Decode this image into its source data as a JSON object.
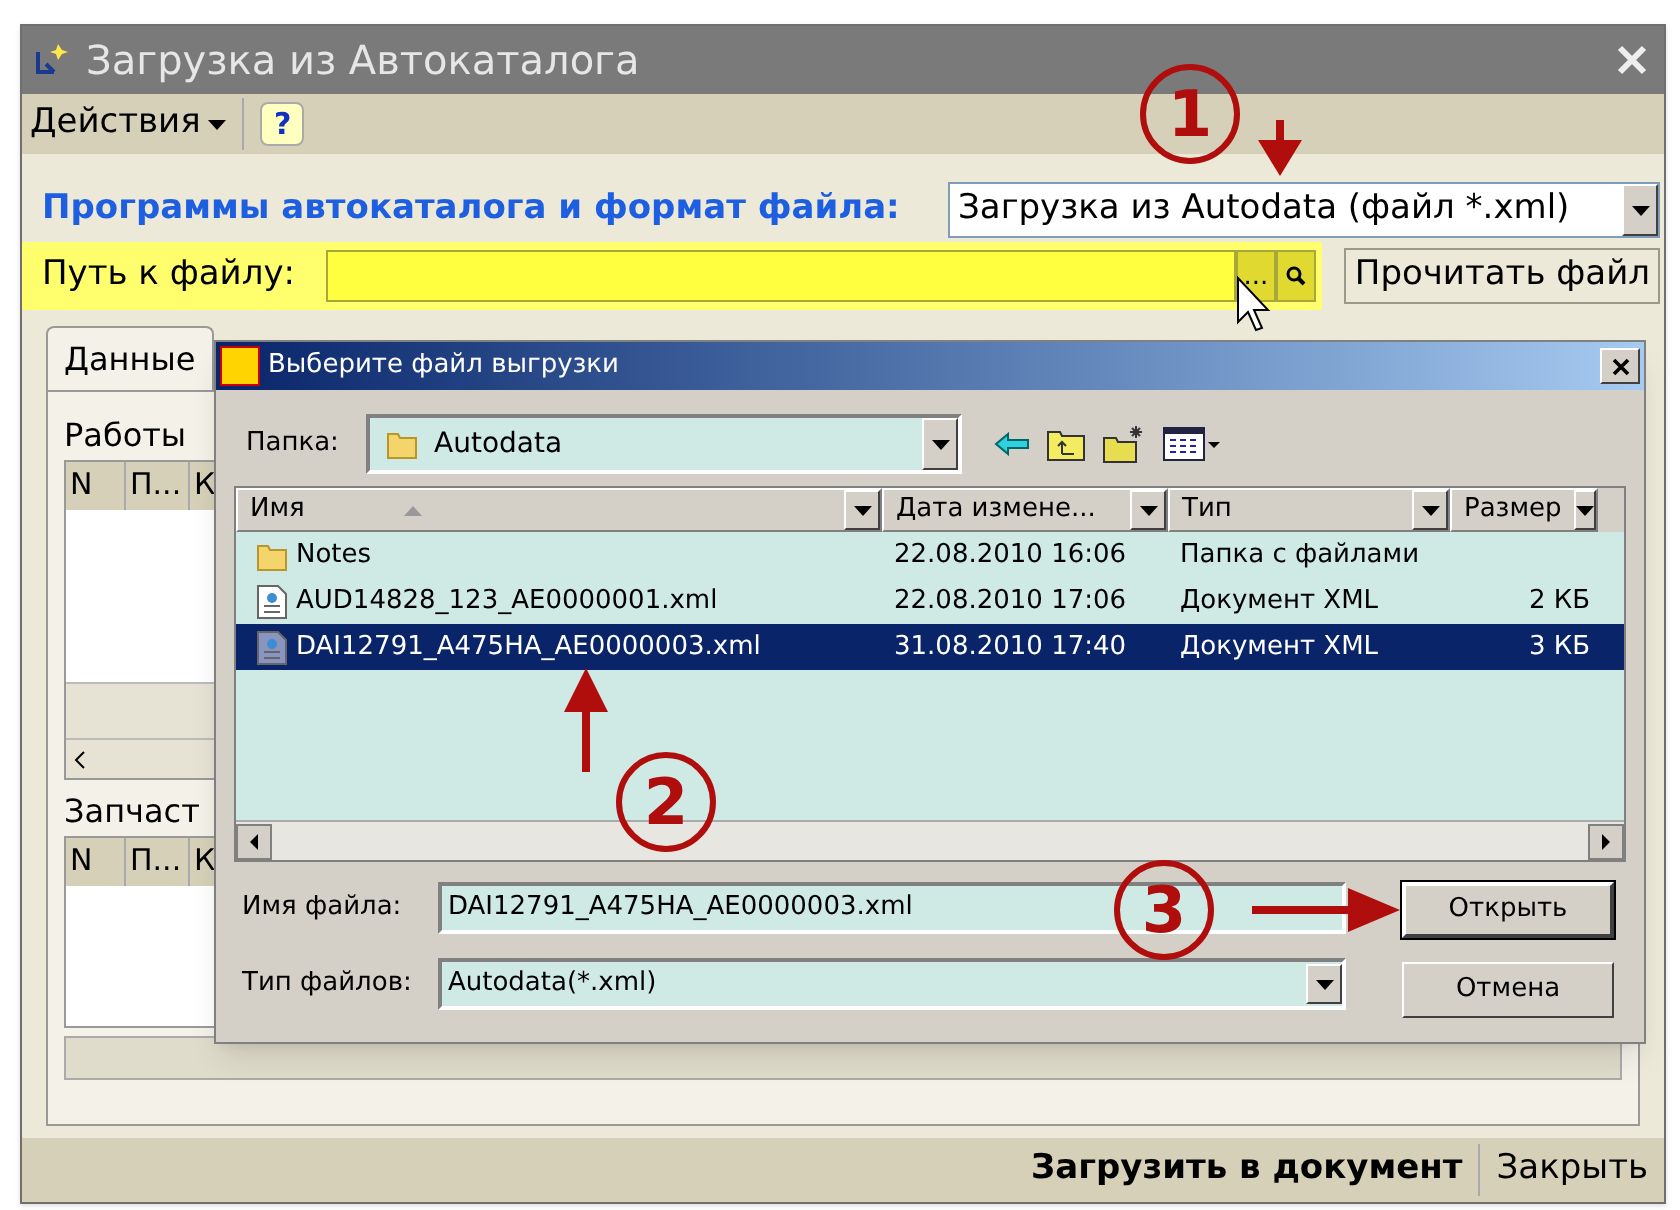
{
  "window": {
    "title": "Загрузка из Автокаталога"
  },
  "toolbar": {
    "actions_menu": "Действия",
    "help": "?"
  },
  "form": {
    "program_label": "Программы автокаталога и формат файла:",
    "program_value": "Загрузка из Autodata (файл *.xml)",
    "path_label": "Путь к файлу:",
    "browse_button": "...",
    "read_button": "Прочитать файл"
  },
  "tabs": [
    {
      "label": "Данные",
      "selected": true
    }
  ],
  "works": {
    "title": "Работы",
    "columns": [
      "N",
      "П...",
      "К"
    ]
  },
  "parts": {
    "title": "Запчаст",
    "columns": [
      "N",
      "П...",
      "К"
    ]
  },
  "footer": {
    "buttons": [
      {
        "label": "Загрузить в документ",
        "primary": true
      },
      {
        "label": "Закрыть",
        "primary": false
      }
    ]
  },
  "dialog": {
    "title": "Выберите файл выгрузки",
    "folder_label": "Папка:",
    "folder": "Autodata",
    "columns": [
      "Имя",
      "Дата измене...",
      "Тип",
      "Размер"
    ],
    "files": [
      {
        "kind": "folder",
        "name": "Notes",
        "date": "22.08.2010 16:06",
        "type": "Папка с файлами",
        "selected": false
      },
      {
        "kind": "xml",
        "name": "AUD14828_123_AE0000001.xml",
        "date": "22.08.2010 17:06",
        "type": "Документ XML",
        "size": "2 КБ",
        "selected": false
      },
      {
        "kind": "xml",
        "name": "DAI12791_A475HA_AE0000003.xml",
        "date": "31.08.2010 17:40",
        "type": "Документ XML",
        "size": "3 КБ",
        "selected": true
      }
    ],
    "file_name_label": "Имя файла:",
    "file_name": "DAI12791_A475HA_AE0000003.xml",
    "file_type_label": "Тип файлов:",
    "file_type": "Autodata(*.xml)",
    "buttons": [
      {
        "label": "Открыть",
        "default": true
      },
      {
        "label": "Отмена",
        "default": false
      }
    ]
  },
  "annotations": [
    {
      "label": "1"
    },
    {
      "label": "2"
    },
    {
      "label": "3"
    }
  ]
}
